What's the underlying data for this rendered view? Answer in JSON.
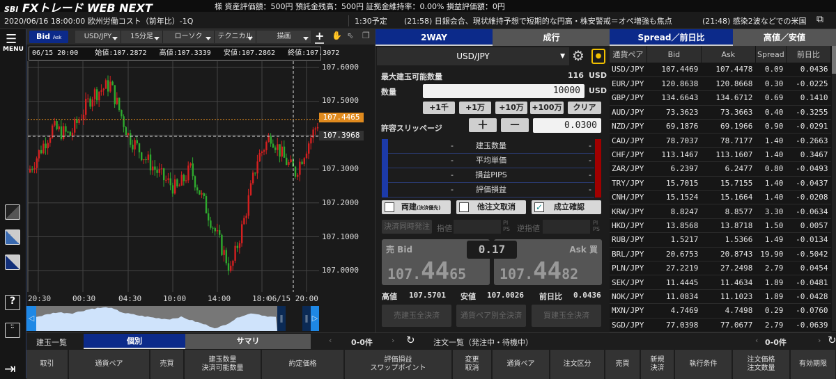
{
  "header": {
    "logo_sbi": "SBI",
    "logo_text": "FXトレード WEB NEXT",
    "account": "様 資産評価額：500円 預託金残高：500円 証拠金維持率：0.00% 損益評価額：0円"
  },
  "news": {
    "items": [
      "2020/06/16 18:00:00 欧州労働コスト（前年比）-1Q",
      "1:30予定",
      "(21:58) 日銀会合、現状維持予想で短期的な円高・株安警戒＝オペ増強も焦点",
      "(21:48) 感染2波などでの米国"
    ]
  },
  "sidebar": {
    "menu": "MENU",
    "help": "?"
  },
  "chart": {
    "toolbar": {
      "bid": "Bid",
      "ask": "Ask",
      "pair": "USD/JPY",
      "timeframe": "15分足",
      "type": "ローソク",
      "technical": "テクニカル",
      "draw": "描画",
      "crosshair": "+"
    },
    "ohlc": {
      "time": "06/15 20:00",
      "open": "始値:107.2872",
      "high": "高値:107.3339",
      "low": "安値:107.2862",
      "close": "終値:107.3072"
    },
    "price_ticks": [
      "107.6000",
      "107.5000",
      "107.4000",
      "107.3000",
      "107.2000",
      "107.1000",
      "107.0000"
    ],
    "current_price": "107.4465",
    "cross_price": "107.3968",
    "time_ticks": [
      "20:30",
      "00:30",
      "04:30",
      "10:00",
      "14:00",
      "18:00"
    ],
    "cross_time": "06/15 20:00",
    "colors": {
      "up": "#d42020",
      "down": "#2eaa2e",
      "current": "#e08a1e"
    }
  },
  "order": {
    "tabs": [
      "2WAY",
      "成行"
    ],
    "pair": "USD/JPY",
    "max_label": "最大建玉可能数量",
    "max_value": "116",
    "unit": "USD",
    "qty_label": "数量",
    "qty_value": "10000",
    "qty_buttons": [
      "+1千",
      "+1万",
      "+10万",
      "+100万",
      "クリア"
    ],
    "slip_label": "許容スリッページ",
    "slip_plus": "＋",
    "slip_minus": "－",
    "slip_value": "0.0300",
    "positions": [
      {
        "label": "建玉数量",
        "sell": "-",
        "buy": "-"
      },
      {
        "label": "平均単価",
        "sell": "-",
        "buy": "-"
      },
      {
        "label": "損益PIPS",
        "sell": "-",
        "buy": "-"
      },
      {
        "label": "評価損益",
        "sell": "-",
        "buy": "-"
      }
    ],
    "checks": [
      {
        "label": "両建",
        "sub": "(決済優先)",
        "checked": false
      },
      {
        "label": "他注文取消",
        "checked": false
      },
      {
        "label": "成立確認",
        "checked": true
      }
    ],
    "settle_btn": "決済同時発注",
    "limit_label": "指値",
    "stop_label": "逆指値",
    "pips": "PI PS",
    "sell_label": "売 Bid",
    "buy_label": "Ask 買",
    "spread": "0.17",
    "bid": {
      "pre": "107.",
      "big": "44",
      "post": "65"
    },
    "ask": {
      "pre": "107.",
      "big": "44",
      "post": "82"
    },
    "high_label": "高値",
    "high": "107.5701",
    "low_label": "安値",
    "low": "107.0026",
    "chg_label": "前日比",
    "chg": "0.0436",
    "close_buttons": [
      "売建玉全決済",
      "通貨ペア別全決済",
      "買建玉全決済"
    ]
  },
  "rates": {
    "tabs": [
      "Spread／前日比",
      "高値／安値"
    ],
    "columns": [
      "通貨ペア",
      "Bid",
      "Ask",
      "Spread",
      "前日比"
    ],
    "rows": [
      [
        "USD/JPY",
        "107.4469",
        "107.4478",
        "0.09",
        "0.0436"
      ],
      [
        "EUR/JPY",
        "120.8638",
        "120.8668",
        "0.30",
        "-0.0225"
      ],
      [
        "GBP/JPY",
        "134.6643",
        "134.6712",
        "0.69",
        "0.1410"
      ],
      [
        "AUD/JPY",
        "73.3623",
        "73.3663",
        "0.40",
        "-0.3255"
      ],
      [
        "NZD/JPY",
        "69.1876",
        "69.1966",
        "0.90",
        "-0.0291"
      ],
      [
        "CAD/JPY",
        "78.7037",
        "78.7177",
        "1.40",
        "-0.2663"
      ],
      [
        "CHF/JPY",
        "113.1467",
        "113.1607",
        "1.40",
        "0.3467"
      ],
      [
        "ZAR/JPY",
        "6.2397",
        "6.2477",
        "0.80",
        "-0.0493"
      ],
      [
        "TRY/JPY",
        "15.7015",
        "15.7155",
        "1.40",
        "-0.0437"
      ],
      [
        "CNH/JPY",
        "15.1524",
        "15.1664",
        "1.40",
        "-0.0208"
      ],
      [
        "KRW/JPY",
        "8.8247",
        "8.8577",
        "3.30",
        "-0.0634"
      ],
      [
        "HKD/JPY",
        "13.8568",
        "13.8718",
        "1.50",
        "0.0057"
      ],
      [
        "RUB/JPY",
        "1.5217",
        "1.5366",
        "1.49",
        "-0.0134"
      ],
      [
        "BRL/JPY",
        "20.6753",
        "20.8743",
        "19.90",
        "-0.5042"
      ],
      [
        "PLN/JPY",
        "27.2219",
        "27.2498",
        "2.79",
        "0.0454"
      ],
      [
        "SEK/JPY",
        "11.4445",
        "11.4634",
        "1.89",
        "-0.0481"
      ],
      [
        "NOK/JPY",
        "11.0834",
        "11.1023",
        "1.89",
        "-0.0428"
      ],
      [
        "MXN/JPY",
        "4.7469",
        "4.7498",
        "0.29",
        "-0.0760"
      ],
      [
        "SGD/JPY",
        "77.0398",
        "77.0677",
        "2.79",
        "-0.0639"
      ]
    ]
  },
  "positions_panel": {
    "title": "建玉一覧",
    "tabs": [
      "個別",
      "サマリ"
    ],
    "count": "0-0件",
    "columns": [
      "取引",
      "通貨ペア",
      "売買",
      "建玉数量\n決済可能数量",
      "約定価格",
      "評価損益\nスワップポイント"
    ]
  },
  "orders_panel": {
    "title": "注文一覧（発注中・待機中）",
    "count": "0-0件",
    "columns": [
      "変更\n取消",
      "通貨ペア",
      "注文区分",
      "売買",
      "新規\n決済",
      "執行条件",
      "注文価格\n注文数量",
      "有効期限"
    ]
  }
}
